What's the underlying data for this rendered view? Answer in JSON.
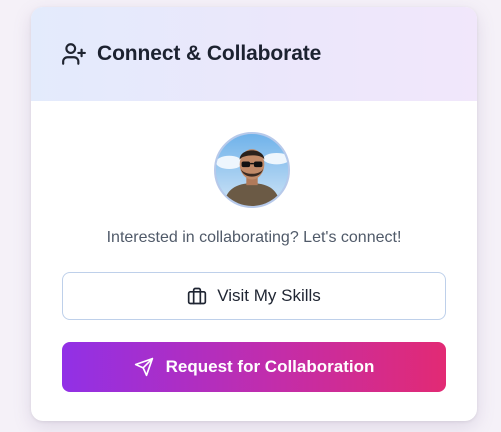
{
  "card": {
    "title": "Connect & Collaborate",
    "title_icon": "user-plus-icon",
    "avatar_icon": "profile-photo",
    "subtitle": "Interested in collaborating? Let's connect!"
  },
  "buttons": {
    "skills": {
      "label": "Visit My Skills",
      "icon": "briefcase-icon"
    },
    "collaborate": {
      "label": "Request for Collaboration",
      "icon": "send-icon"
    }
  },
  "colors": {
    "gradient_start": "#9130e6",
    "gradient_end": "#e22a74",
    "header_bg": "#e3ebfc",
    "outline_border": "#bed0ea"
  }
}
